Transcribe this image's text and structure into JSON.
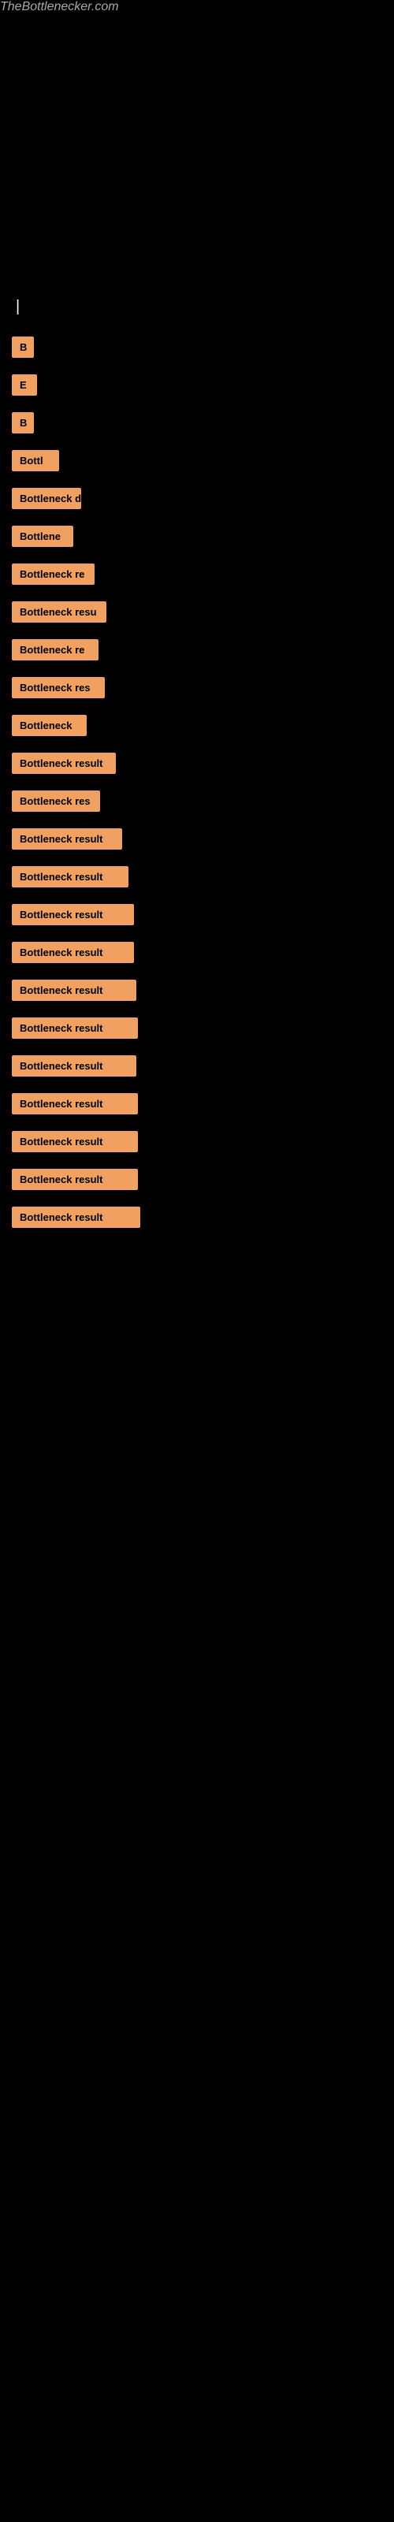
{
  "site": {
    "title": "TheBottlenecker.com"
  },
  "results": [
    {
      "id": 1,
      "label": "B",
      "row_class": "row-1"
    },
    {
      "id": 2,
      "label": "E",
      "row_class": "row-2"
    },
    {
      "id": 3,
      "label": "B",
      "row_class": "row-3"
    },
    {
      "id": 4,
      "label": "Bottl",
      "row_class": "row-4"
    },
    {
      "id": 5,
      "label": "Bottleneck d",
      "row_class": "row-5"
    },
    {
      "id": 6,
      "label": "Bottlene",
      "row_class": "row-6"
    },
    {
      "id": 7,
      "label": "Bottleneck re",
      "row_class": "row-7"
    },
    {
      "id": 8,
      "label": "Bottleneck resu",
      "row_class": "row-8"
    },
    {
      "id": 9,
      "label": "Bottleneck re",
      "row_class": "row-9"
    },
    {
      "id": 10,
      "label": "Bottleneck res",
      "row_class": "row-10"
    },
    {
      "id": 11,
      "label": "Bottleneck",
      "row_class": "row-11"
    },
    {
      "id": 12,
      "label": "Bottleneck result",
      "row_class": "row-12"
    },
    {
      "id": 13,
      "label": "Bottleneck res",
      "row_class": "row-13"
    },
    {
      "id": 14,
      "label": "Bottleneck result",
      "row_class": "row-14"
    },
    {
      "id": 15,
      "label": "Bottleneck result",
      "row_class": "row-15"
    },
    {
      "id": 16,
      "label": "Bottleneck result",
      "row_class": "row-16"
    },
    {
      "id": 17,
      "label": "Bottleneck result",
      "row_class": "row-17"
    },
    {
      "id": 18,
      "label": "Bottleneck result",
      "row_class": "row-18"
    },
    {
      "id": 19,
      "label": "Bottleneck result",
      "row_class": "row-19"
    },
    {
      "id": 20,
      "label": "Bottleneck result",
      "row_class": "row-20"
    },
    {
      "id": 21,
      "label": "Bottleneck result",
      "row_class": "row-21"
    },
    {
      "id": 22,
      "label": "Bottleneck result",
      "row_class": "row-22"
    },
    {
      "id": 23,
      "label": "Bottleneck result",
      "row_class": "row-23"
    },
    {
      "id": 24,
      "label": "Bottleneck result",
      "row_class": "row-24"
    }
  ]
}
